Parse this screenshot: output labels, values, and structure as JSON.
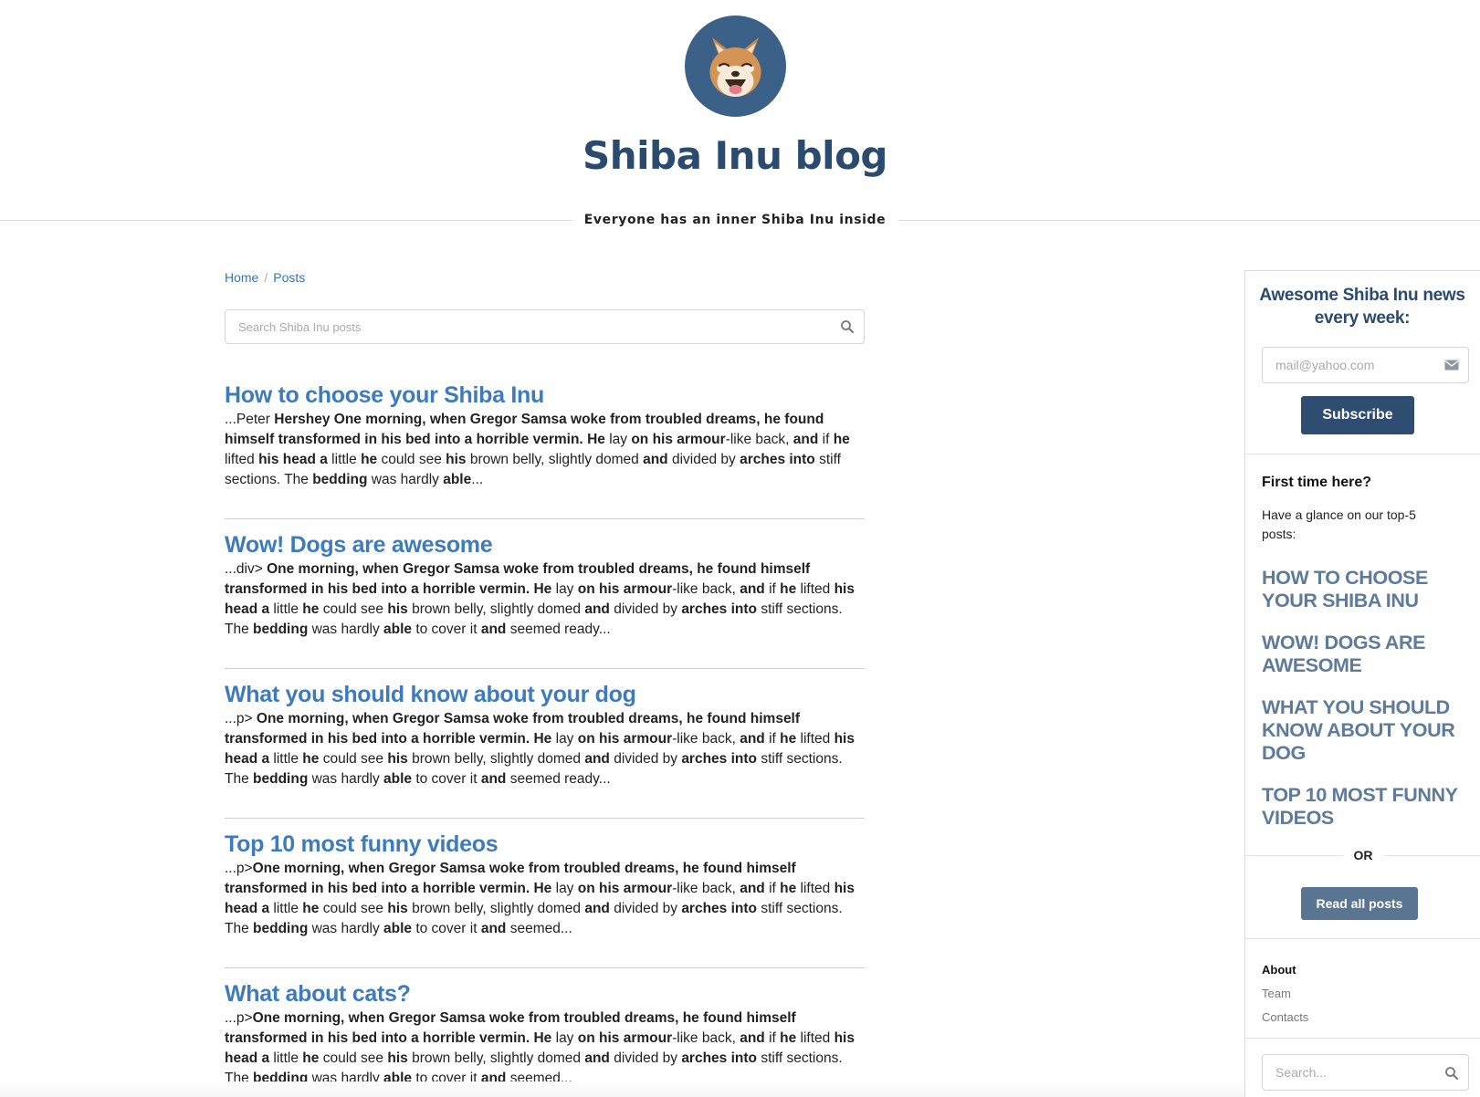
{
  "header": {
    "title": "Shiba Inu blog",
    "tagline": "Everyone has an inner Shiba Inu inside",
    "logo_icon": "shiba-inu-face-icon",
    "logo_bg": "#3b6189"
  },
  "breadcrumb": {
    "items": [
      {
        "label": "Home"
      },
      {
        "label": "Posts"
      }
    ],
    "separator": "/"
  },
  "search": {
    "placeholder": "Search Shiba Inu posts",
    "icon": "search-icon"
  },
  "posts": [
    {
      "title": "How to choose your Shiba Inu",
      "excerpt": [
        [
          "...Peter ",
          false
        ],
        [
          "Hershey",
          true
        ],
        [
          "   ",
          false
        ],
        [
          "One morning, when Gregor Samsa woke from troubled dreams, he found himself transformed in his bed into a horrible vermin.",
          true
        ],
        [
          " ",
          false
        ],
        [
          "He",
          true
        ],
        [
          " lay ",
          false
        ],
        [
          "on his armour",
          true
        ],
        [
          "-like back, ",
          false
        ],
        [
          "and",
          true
        ],
        [
          " if ",
          false
        ],
        [
          "he",
          true
        ],
        [
          " lifted ",
          false
        ],
        [
          "his head a",
          true
        ],
        [
          " little ",
          false
        ],
        [
          "he",
          true
        ],
        [
          " could see ",
          false
        ],
        [
          "his",
          true
        ],
        [
          " brown belly, slightly domed ",
          false
        ],
        [
          "and",
          true
        ],
        [
          " divided by ",
          false
        ],
        [
          "arches into",
          true
        ],
        [
          " stiff sections. The ",
          false
        ],
        [
          "bedding",
          true
        ],
        [
          " was hardly ",
          false
        ],
        [
          "able",
          true
        ],
        [
          "...",
          false
        ]
      ]
    },
    {
      "title": "Wow! Dogs are awesome",
      "excerpt": [
        [
          "...div> ",
          false
        ],
        [
          "One morning, when Gregor Samsa woke from troubled dreams, he found himself transformed in his bed into a horrible vermin.",
          true
        ],
        [
          " ",
          false
        ],
        [
          "He",
          true
        ],
        [
          " lay ",
          false
        ],
        [
          "on his armour",
          true
        ],
        [
          "-like back, ",
          false
        ],
        [
          "and",
          true
        ],
        [
          " if ",
          false
        ],
        [
          "he",
          true
        ],
        [
          " lifted ",
          false
        ],
        [
          "his head a",
          true
        ],
        [
          " little ",
          false
        ],
        [
          "he",
          true
        ],
        [
          " could see ",
          false
        ],
        [
          "his",
          true
        ],
        [
          " brown belly, slightly domed ",
          false
        ],
        [
          "and",
          true
        ],
        [
          " divided by ",
          false
        ],
        [
          "arches into",
          true
        ],
        [
          " stiff sections. The ",
          false
        ],
        [
          "bedding",
          true
        ],
        [
          " was hardly ",
          false
        ],
        [
          "able",
          true
        ],
        [
          " to cover it ",
          false
        ],
        [
          "and",
          true
        ],
        [
          " seemed ready...",
          false
        ]
      ]
    },
    {
      "title": "What you should know about your dog",
      "excerpt": [
        [
          "...p> ",
          false
        ],
        [
          "One morning, when Gregor Samsa woke from troubled dreams, he found himself transformed in his bed into a horrible vermin.",
          true
        ],
        [
          " ",
          false
        ],
        [
          "He",
          true
        ],
        [
          " lay ",
          false
        ],
        [
          "on his armour",
          true
        ],
        [
          "-like back, ",
          false
        ],
        [
          "and",
          true
        ],
        [
          " if ",
          false
        ],
        [
          "he",
          true
        ],
        [
          " lifted ",
          false
        ],
        [
          "his head a",
          true
        ],
        [
          " little ",
          false
        ],
        [
          "he",
          true
        ],
        [
          " could see ",
          false
        ],
        [
          "his",
          true
        ],
        [
          " brown belly, slightly domed ",
          false
        ],
        [
          "and",
          true
        ],
        [
          " divided by ",
          false
        ],
        [
          "arches into",
          true
        ],
        [
          " stiff sections. The ",
          false
        ],
        [
          "bedding",
          true
        ],
        [
          " was hardly ",
          false
        ],
        [
          "able",
          true
        ],
        [
          " to cover it ",
          false
        ],
        [
          "and",
          true
        ],
        [
          " seemed ready...",
          false
        ]
      ]
    },
    {
      "title": "Top 10 most funny videos",
      "excerpt": [
        [
          "...p>",
          false
        ],
        [
          "One morning, when Gregor Samsa woke from troubled dreams, he found himself transformed in his bed into a horrible vermin.",
          true
        ],
        [
          " ",
          false
        ],
        [
          "He",
          true
        ],
        [
          " lay ",
          false
        ],
        [
          "on his armour",
          true
        ],
        [
          "-like back, ",
          false
        ],
        [
          "and",
          true
        ],
        [
          " if ",
          false
        ],
        [
          "he",
          true
        ],
        [
          " lifted ",
          false
        ],
        [
          "his head a",
          true
        ],
        [
          " little ",
          false
        ],
        [
          "he",
          true
        ],
        [
          " could see ",
          false
        ],
        [
          "his",
          true
        ],
        [
          " brown belly, slightly domed ",
          false
        ],
        [
          "and",
          true
        ],
        [
          " divided by ",
          false
        ],
        [
          "arches into",
          true
        ],
        [
          " stiff sections. The ",
          false
        ],
        [
          "bedding",
          true
        ],
        [
          " was hardly ",
          false
        ],
        [
          "able",
          true
        ],
        [
          " to cover it ",
          false
        ],
        [
          "and",
          true
        ],
        [
          " seemed...",
          false
        ]
      ]
    },
    {
      "title": "What about cats?",
      "excerpt": [
        [
          "...p>",
          false
        ],
        [
          "One morning, when Gregor Samsa woke from troubled dreams, he found himself transformed in his bed into a horrible vermin.",
          true
        ],
        [
          " ",
          false
        ],
        [
          "He",
          true
        ],
        [
          " lay ",
          false
        ],
        [
          "on his armour",
          true
        ],
        [
          "-like back, ",
          false
        ],
        [
          "and",
          true
        ],
        [
          " if ",
          false
        ],
        [
          "he",
          true
        ],
        [
          " lifted ",
          false
        ],
        [
          "his head a",
          true
        ],
        [
          " little ",
          false
        ],
        [
          "he",
          true
        ],
        [
          " could see ",
          false
        ],
        [
          "his",
          true
        ],
        [
          " brown belly, slightly domed ",
          false
        ],
        [
          "and",
          true
        ],
        [
          " divided by ",
          false
        ],
        [
          "arches into",
          true
        ],
        [
          " stiff sections. The ",
          false
        ],
        [
          "bedding",
          true
        ],
        [
          " was hardly ",
          false
        ],
        [
          "able",
          true
        ],
        [
          " to cover it ",
          false
        ],
        [
          "and",
          true
        ],
        [
          " seemed...",
          false
        ]
      ]
    }
  ],
  "sidebar": {
    "newsletter": {
      "title": "Awesome Shiba Inu news every week:",
      "email_placeholder": "mail@yahoo.com",
      "email_icon": "envelope-icon",
      "subscribe_label": "Subscribe"
    },
    "first_time": {
      "heading": "First time here?",
      "text": "Have a glance on our top-5 posts:",
      "top_posts": [
        "How to choose your Shiba Inu",
        "Wow! Dogs are awesome",
        "What you should know about your dog",
        "Top 10 most funny videos"
      ],
      "or_label": "OR",
      "read_all_label": "Read all posts"
    },
    "links": [
      {
        "label": "About",
        "active": true
      },
      {
        "label": "Team",
        "active": false
      },
      {
        "label": "Contacts",
        "active": false
      }
    ],
    "search": {
      "placeholder": "Search...",
      "icon": "search-icon"
    }
  },
  "colors": {
    "title": "#2a4a6e",
    "post_link": "#3e7bbd",
    "top_post_link": "#5e7b99",
    "subscribe_bg": "#2f4d70",
    "read_all_bg": "#5a7592"
  }
}
